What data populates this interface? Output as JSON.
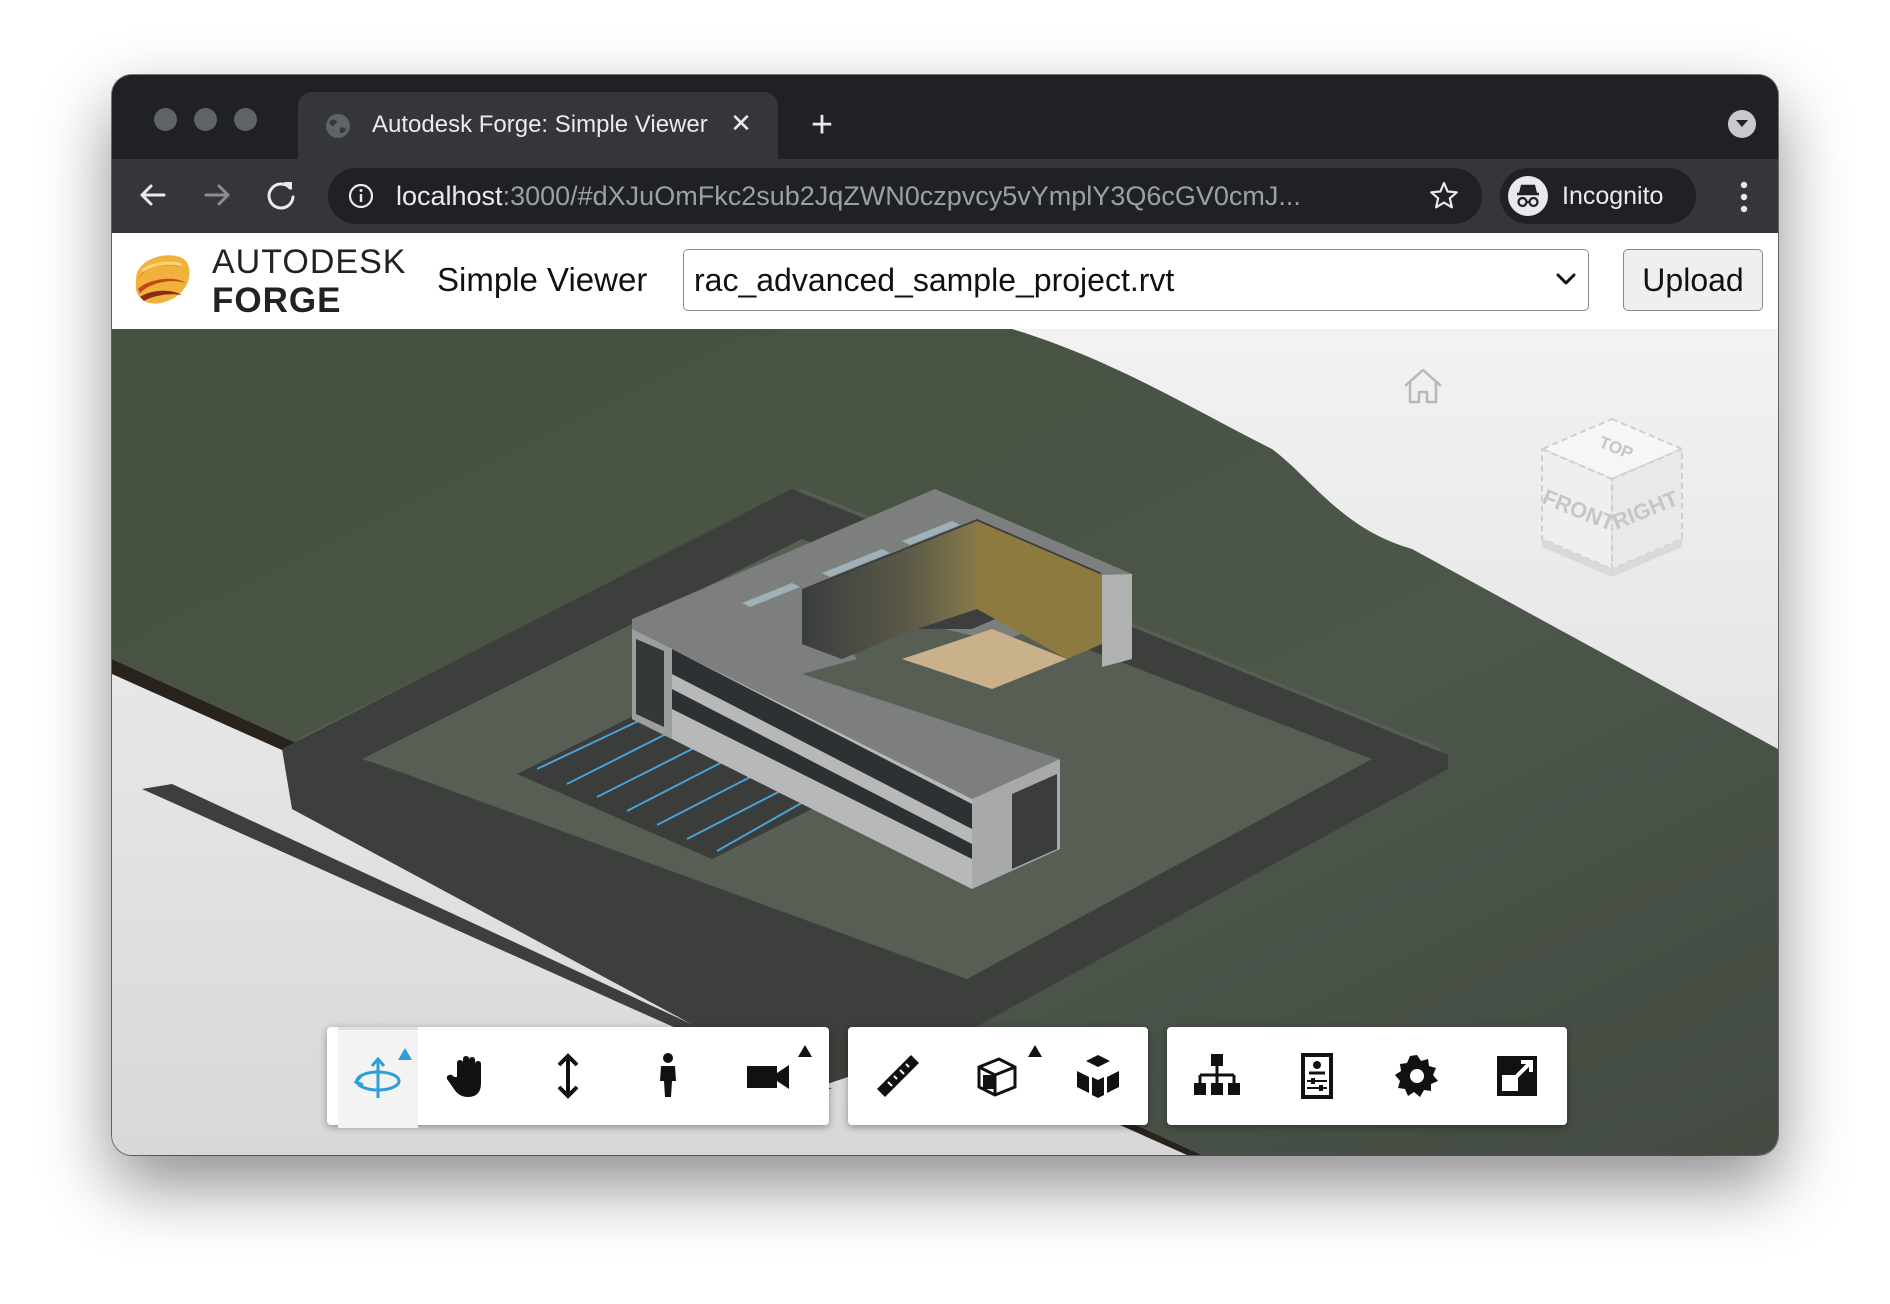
{
  "browser": {
    "tab_title": "Autodesk Forge: Simple Viewer",
    "tab_close": "✕",
    "new_tab": "+",
    "url_host": "localhost",
    "url_rest": ":3000/#dXJuOmFkc2sub2JqZWN0czpvcy5vYmplY3Q6cGV0cmJ...",
    "profile_label": "Incognito"
  },
  "app": {
    "logo_line1": "AUTODESK",
    "logo_line2": "FORGE",
    "title": "Simple Viewer",
    "model_select": {
      "selected": "rac_advanced_sample_project.rvt"
    },
    "upload_label": "Upload"
  },
  "viewer": {
    "viewcube": {
      "faces": [
        "TOP",
        "FRONT",
        "RIGHT"
      ]
    },
    "toolbar": {
      "groups": [
        {
          "name": "navigation",
          "tools": [
            "orbit-icon",
            "pan-icon",
            "zoom-icon",
            "first-person-icon",
            "camera-icon"
          ],
          "active": "orbit-icon"
        },
        {
          "name": "modeling",
          "tools": [
            "measure-icon",
            "section-icon",
            "explode-icon"
          ]
        },
        {
          "name": "settings",
          "tools": [
            "model-browser-icon",
            "properties-icon",
            "settings-icon",
            "fullscreen-icon"
          ]
        }
      ]
    },
    "colors": {
      "accent": "#2c9fd6",
      "terrain": "#4b5548",
      "site": "#5a6358",
      "road": "#3c3f3b"
    }
  }
}
